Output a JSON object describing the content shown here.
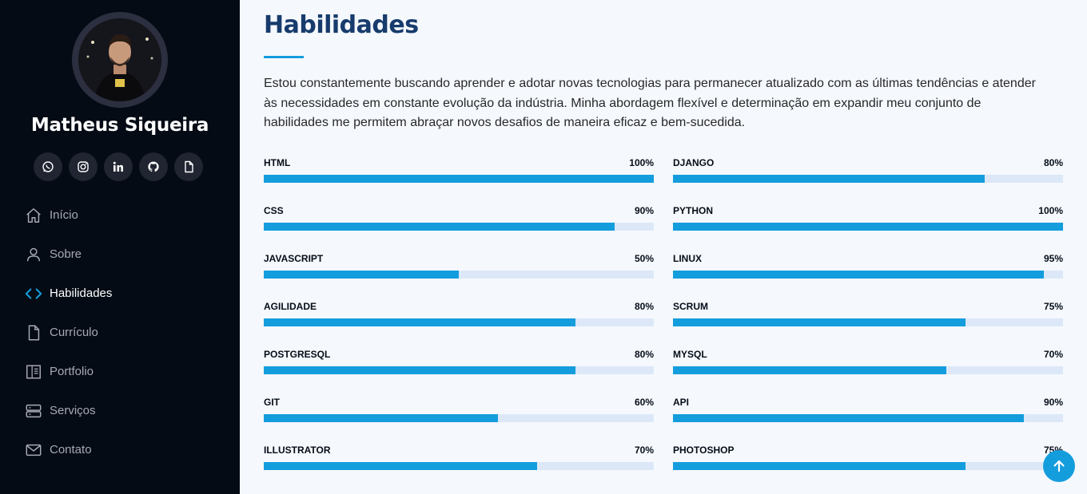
{
  "profile": {
    "name": "Matheus Siqueira"
  },
  "social": [
    {
      "name": "whatsapp-icon"
    },
    {
      "name": "instagram-icon"
    },
    {
      "name": "linkedin-icon"
    },
    {
      "name": "github-icon"
    },
    {
      "name": "document-icon"
    }
  ],
  "nav": [
    {
      "label": "Início",
      "icon": "home-icon",
      "active": false
    },
    {
      "label": "Sobre",
      "icon": "person-icon",
      "active": false
    },
    {
      "label": "Habilidades",
      "icon": "code-icon",
      "active": true
    },
    {
      "label": "Currículo",
      "icon": "file-icon",
      "active": false
    },
    {
      "label": "Portfolio",
      "icon": "book-icon",
      "active": false
    },
    {
      "label": "Serviços",
      "icon": "server-icon",
      "active": false
    },
    {
      "label": "Contato",
      "icon": "envelope-icon",
      "active": false
    }
  ],
  "section": {
    "title": "Habilidades",
    "intro": "Estou constantemente buscando aprender e adotar novas tecnologias para permanecer atualizado com as últimas tendências e atender às necessidades em constante evolução da indústria. Minha abordagem flexível e determinação em expandir meu conjunto de habilidades me permitem abraçar novos desafios de maneira eficaz e bem-sucedida."
  },
  "skills_left": [
    {
      "label": "HTML",
      "value": "100%",
      "percent": 100
    },
    {
      "label": "CSS",
      "value": "90%",
      "percent": 90
    },
    {
      "label": "JAVASCRIPT",
      "value": "50%",
      "percent": 50
    },
    {
      "label": "AGILIDADE",
      "value": "80%",
      "percent": 80
    },
    {
      "label": "POSTGRESQL",
      "value": "80%",
      "percent": 80
    },
    {
      "label": "GIT",
      "value": "60%",
      "percent": 60
    },
    {
      "label": "ILLUSTRATOR",
      "value": "70%",
      "percent": 70
    }
  ],
  "skills_right": [
    {
      "label": "DJANGO",
      "value": "80%",
      "percent": 80
    },
    {
      "label": "PYTHON",
      "value": "100%",
      "percent": 100
    },
    {
      "label": "LINUX",
      "value": "95%",
      "percent": 95
    },
    {
      "label": "SCRUM",
      "value": "75%",
      "percent": 75
    },
    {
      "label": "MYSQL",
      "value": "70%",
      "percent": 70
    },
    {
      "label": "API",
      "value": "90%",
      "percent": 90
    },
    {
      "label": "PHOTOSHOP",
      "value": "75%",
      "percent": 75
    }
  ],
  "colors": {
    "accent": "#149ddd",
    "sidebar_bg": "#040b14",
    "title": "#173b6c",
    "track": "#dce8f8",
    "page_bg": "#f5f8fd"
  },
  "back_to_top_icon": "arrow-up-icon"
}
